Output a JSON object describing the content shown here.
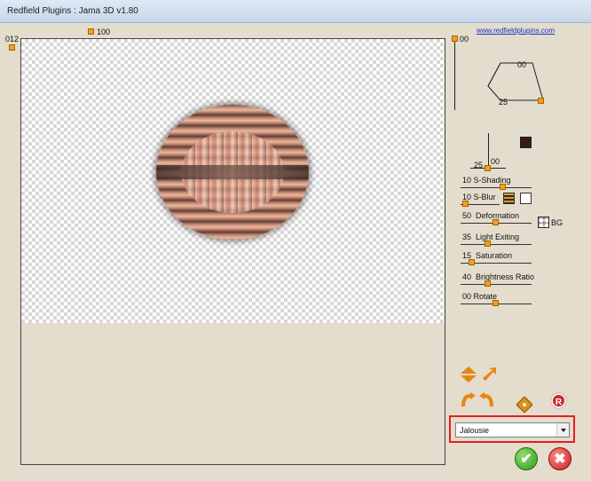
{
  "window": {
    "title": "Redfield Plugins : Jama 3D  v1.80"
  },
  "link": {
    "text": "www.redfieldplugins.com"
  },
  "preview": {
    "top_value": "100",
    "left_value": "012"
  },
  "rotation_box": {
    "vertical_value": "00",
    "top_value": "00",
    "bottom_value": "25"
  },
  "light_box": {
    "value_a": "00",
    "value_b": "25"
  },
  "sliders": [
    {
      "value": "10",
      "label": "S-Shading",
      "level": 0.55
    },
    {
      "value": "10",
      "label": "S-Blur",
      "level": 0.05
    },
    {
      "value": "50",
      "label": "Deformation",
      "level": 0.5
    },
    {
      "value": "35",
      "label": "Light Exiting",
      "level": 0.38
    },
    {
      "value": "15",
      "label": "Saturation",
      "level": 0.12
    },
    {
      "value": "40",
      "label": "Brightness Ratio",
      "level": 0.38
    },
    {
      "value": "00",
      "label": "Rotate",
      "level": 0.48
    }
  ],
  "bg_label": "BG",
  "icons": {
    "flip_vertical": "flip-vertical-icon",
    "expand": "expand-arrow-icon",
    "rotate": "rotate-arrows-icon",
    "move": "move-icon",
    "reset": "R",
    "ok": "✔",
    "cancel": "✖"
  },
  "dropdown": {
    "value": "Jalousie"
  }
}
